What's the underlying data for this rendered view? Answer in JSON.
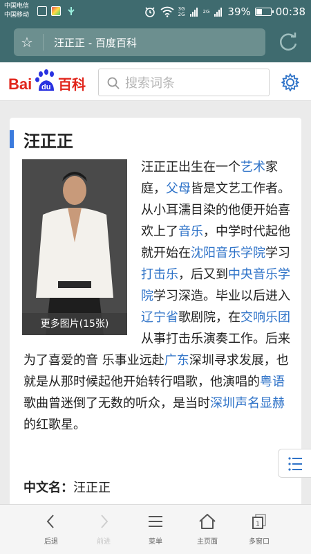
{
  "status_bar": {
    "carrier1": "中国电信",
    "carrier2": "中国移动",
    "network_labels": [
      "3G",
      "2G",
      "2G"
    ],
    "battery": "39%",
    "time": "00:38"
  },
  "browser": {
    "url_title": "汪正正 - 百度百科"
  },
  "baike": {
    "logo_text_latin": "Bai",
    "logo_text_du": "du",
    "logo_text_cn": "百科",
    "search_placeholder": "搜索词条"
  },
  "article": {
    "title": "汪正正",
    "photo_caption": "更多图片(15张)",
    "segments": [
      {
        "t": "汪正正出生在一个",
        "link": false
      },
      {
        "t": "艺术",
        "link": true
      },
      {
        "t": "家庭，",
        "link": false
      },
      {
        "t": "父母",
        "link": true
      },
      {
        "t": "皆是文艺工作者。从小耳濡目染的他便开始喜欢上了",
        "link": false
      },
      {
        "t": "音乐",
        "link": true
      },
      {
        "t": "，中学时代起他就开始在",
        "link": false
      },
      {
        "t": "沈阳音乐学院",
        "link": true
      },
      {
        "t": "学习",
        "link": false
      },
      {
        "t": "打击乐",
        "link": true
      },
      {
        "t": "，后又到",
        "link": false
      },
      {
        "t": "中央音乐学院",
        "link": true
      },
      {
        "t": "学习深造。毕业以后进入",
        "link": false
      },
      {
        "t": "辽宁省",
        "link": true
      },
      {
        "t": "歌剧院，在",
        "link": false
      },
      {
        "t": "交响乐团",
        "link": true
      },
      {
        "t": "从事打击乐演奏工作。后来为了喜爱的音 乐事业远赴",
        "link": false
      },
      {
        "t": "广东",
        "link": true
      },
      {
        "t": "深圳寻求发展，也就是从那时候起他开始转行唱歌，他演唱的",
        "link": false
      },
      {
        "t": "粤语",
        "link": true
      },
      {
        "t": "歌曲曾迷倒了无数的听众，是当时",
        "link": false
      },
      {
        "t": "深圳声名显赫",
        "link": true
      },
      {
        "t": "的红歌星。",
        "link": false
      }
    ],
    "field_label": "中文名：",
    "field_value": "汪正正"
  },
  "nav": {
    "back": "后退",
    "forward": "前进",
    "menu": "菜单",
    "home": "主页面",
    "windows": "多窗口",
    "windows_count": "1"
  },
  "colors": {
    "statusbar_bg": "#3f6b6f",
    "link": "#2f73c8",
    "accent": "#3b7bdd"
  }
}
